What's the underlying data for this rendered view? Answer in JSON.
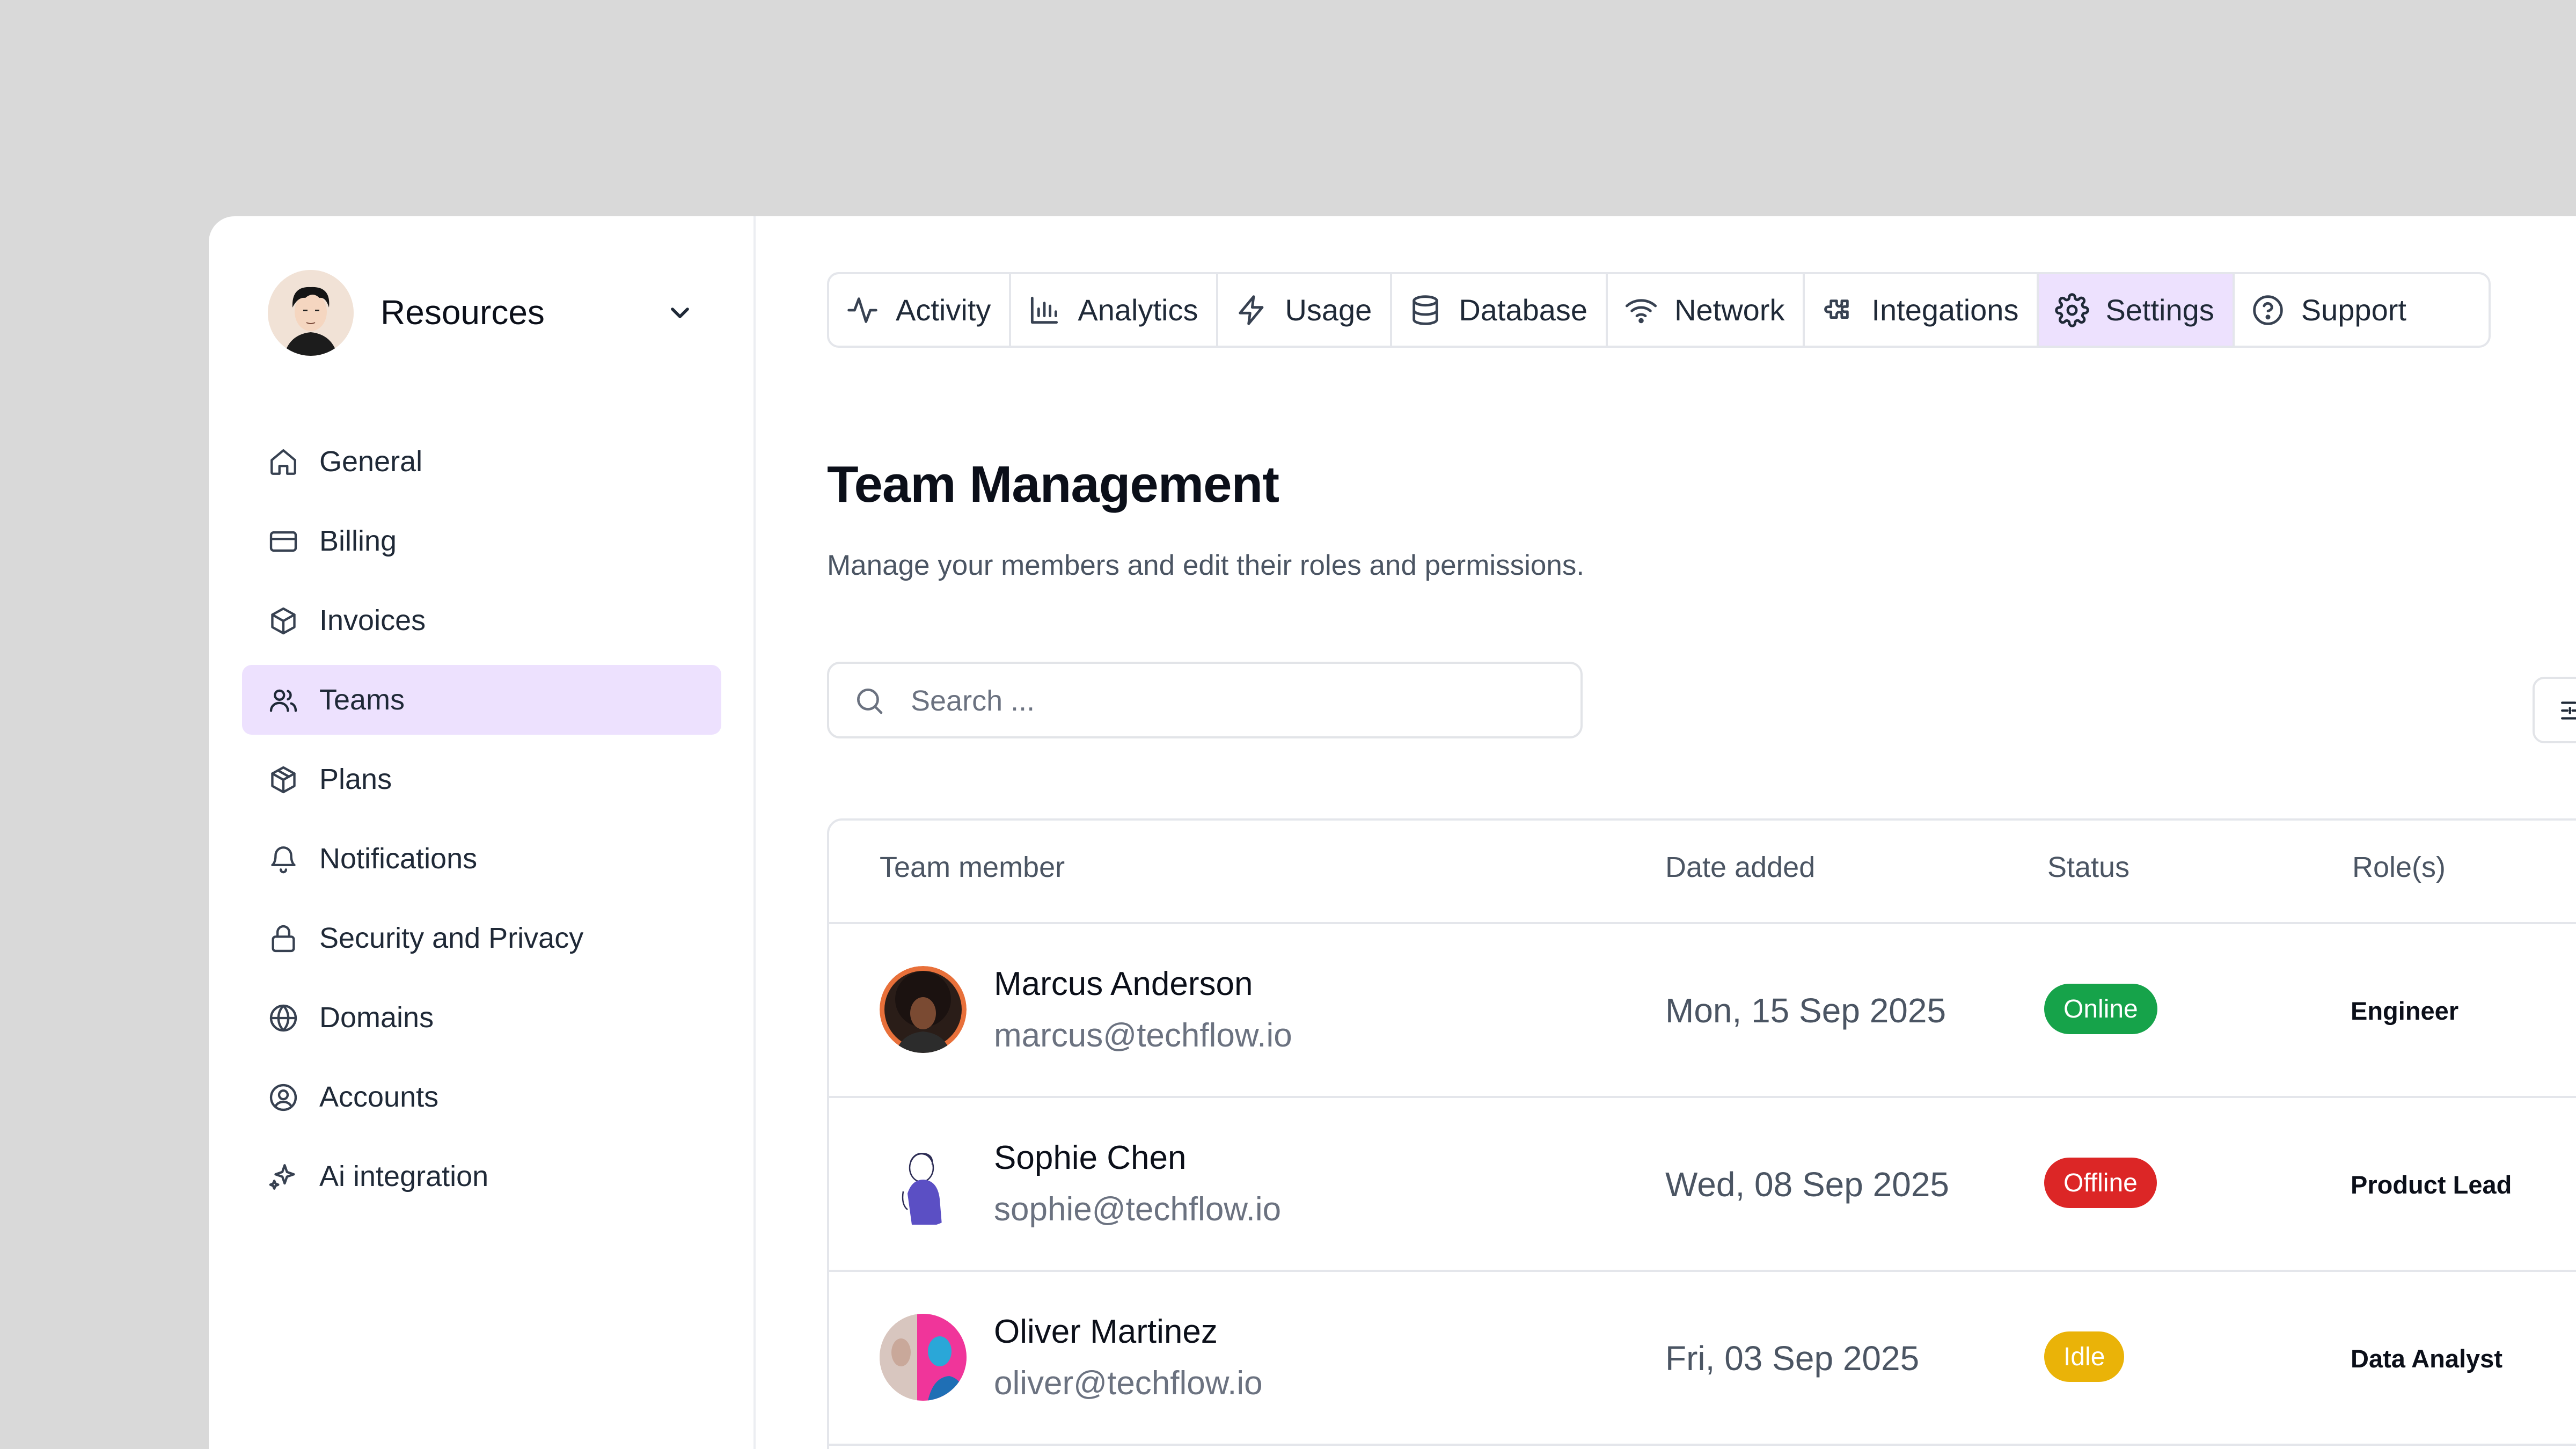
{
  "workspace": {
    "name": "Resources"
  },
  "sidebar": {
    "items": [
      {
        "label": "General",
        "icon": "home-icon",
        "active": false
      },
      {
        "label": "Billing",
        "icon": "credit-card-icon",
        "active": false
      },
      {
        "label": "Invoices",
        "icon": "box-icon",
        "active": false
      },
      {
        "label": "Teams",
        "icon": "users-icon",
        "active": true
      },
      {
        "label": "Plans",
        "icon": "package-icon",
        "active": false
      },
      {
        "label": "Notifications",
        "icon": "bell-icon",
        "active": false
      },
      {
        "label": "Security and Privacy",
        "icon": "lock-icon",
        "active": false
      },
      {
        "label": "Domains",
        "icon": "globe-icon",
        "active": false
      },
      {
        "label": "Accounts",
        "icon": "user-circle-icon",
        "active": false
      },
      {
        "label": "Ai integration",
        "icon": "sparkles-icon",
        "active": false
      }
    ]
  },
  "tabs": [
    {
      "label": "Activity",
      "icon": "activity-icon",
      "active": false
    },
    {
      "label": "Analytics",
      "icon": "bar-chart-icon",
      "active": false
    },
    {
      "label": "Usage",
      "icon": "zap-icon",
      "active": false
    },
    {
      "label": "Database",
      "icon": "database-icon",
      "active": false
    },
    {
      "label": "Network",
      "icon": "wifi-icon",
      "active": false
    },
    {
      "label": "Integations",
      "icon": "puzzle-icon",
      "active": false
    },
    {
      "label": "Settings",
      "icon": "gear-icon",
      "active": true
    },
    {
      "label": "Support",
      "icon": "help-circle-icon",
      "active": false
    }
  ],
  "main": {
    "title": "Team Management",
    "subtitle": "Manage your members and edit their roles and permissions.",
    "search": {
      "placeholder": "Search ...",
      "value": ""
    }
  },
  "table": {
    "columns": [
      "Team member",
      "Date added",
      "Status",
      "Role(s)"
    ],
    "rows": [
      {
        "name": "Marcus Anderson",
        "email": "marcus@techflow.io",
        "date": "Mon, 15 Sep 2025",
        "status": "Online",
        "role": "Engineer"
      },
      {
        "name": "Sophie Chen",
        "email": "sophie@techflow.io",
        "date": "Wed, 08 Sep 2025",
        "status": "Offline",
        "role": "Product Lead"
      },
      {
        "name": "Oliver Martinez",
        "email": "oliver@techflow.io",
        "date": "Fri, 03 Sep 2025",
        "status": "Idle",
        "role": "Data Analyst"
      }
    ]
  },
  "colors": {
    "active_bg": "#ede1fe",
    "status_online": "#16a34a",
    "status_offline": "#dc2626",
    "status_idle": "#eab308"
  }
}
